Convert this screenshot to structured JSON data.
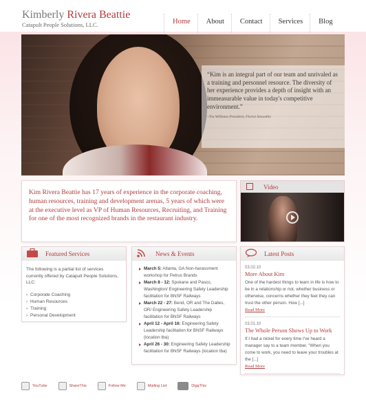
{
  "header": {
    "name_first": "Kimberly ",
    "name_last": "Rivera Beattie",
    "company": "Catapult People Solutions, LLC."
  },
  "nav": [
    "Home",
    "About",
    "Contact",
    "Services",
    "Blog"
  ],
  "hero": {
    "quote": "“Kim is an integral part of our team and unrivaled as a training and personnel resource. The diversity of her experience provides a depth of insight with an immeasurable value in today's competitive environment.”",
    "attribution": "–Tru Williams President, Florist Smoothie"
  },
  "intro": "Kim Rivera Beattie has 17 years of experience in the corporate coaching, human resources, training and development arenas, 5 years of which were at the executive level as VP of Human Resources, Recruiting, and Training for one of the most recognized brands in the restaurant industry.",
  "video": {
    "title": "Video"
  },
  "featured_services": {
    "title": "Featured Services",
    "intro": "The following is a partial list of services currently offered by Catapult People Solutions, LLC:",
    "items": [
      "Corporate Coaching",
      "Human Resources",
      "Training",
      "Personal Development"
    ]
  },
  "news": {
    "title": "News & Events",
    "items": [
      {
        "date": "March 5:",
        "text": " Atlanta, GA Non-harassment workshop for Petrus Brands"
      },
      {
        "date": "March 8 - 12:",
        "text": " Spokane and Pasco, Washington/ Engineering Safety Leadership facilitation for BNSF Railways"
      },
      {
        "date": "March 22 - 27:",
        "text": " Bend, OR and The Dalles, OR/ Engineering Safety Leadership facilitation for BNSF Railways"
      },
      {
        "date": "April 12 - April 16:",
        "text": " Engineering Safety Leadership facilitation for BNSF Railways (location tba)"
      },
      {
        "date": "April 26 - 30:",
        "text": " Engineering Safety Leadership facilitation for BNSF Railways (location tba)"
      }
    ]
  },
  "posts": {
    "title": "Latest Posts",
    "items": [
      {
        "date": "03.02.10",
        "title": "More About Kim",
        "body": "One of the hardest things to learn in life is how to be in a relationship or not, whether business or otherwise, concerns whether they feel they can trust the other person. How [...]",
        "more": "Read More"
      },
      {
        "date": "03.01.10",
        "title": "The Whole Person Shows Up to Work",
        "body": "If I had a nickel for every time I've heard a manager say to a team member, “When you come to work, you need to leave your troubles at the [...]",
        "more": "Read More"
      }
    ]
  },
  "footer": [
    "YouTube",
    "ShareThis",
    "Follow Me",
    "Mailing List",
    "DiggThis"
  ],
  "colors": {
    "accent": "#b23a3a",
    "band": "#fbe3e6"
  }
}
